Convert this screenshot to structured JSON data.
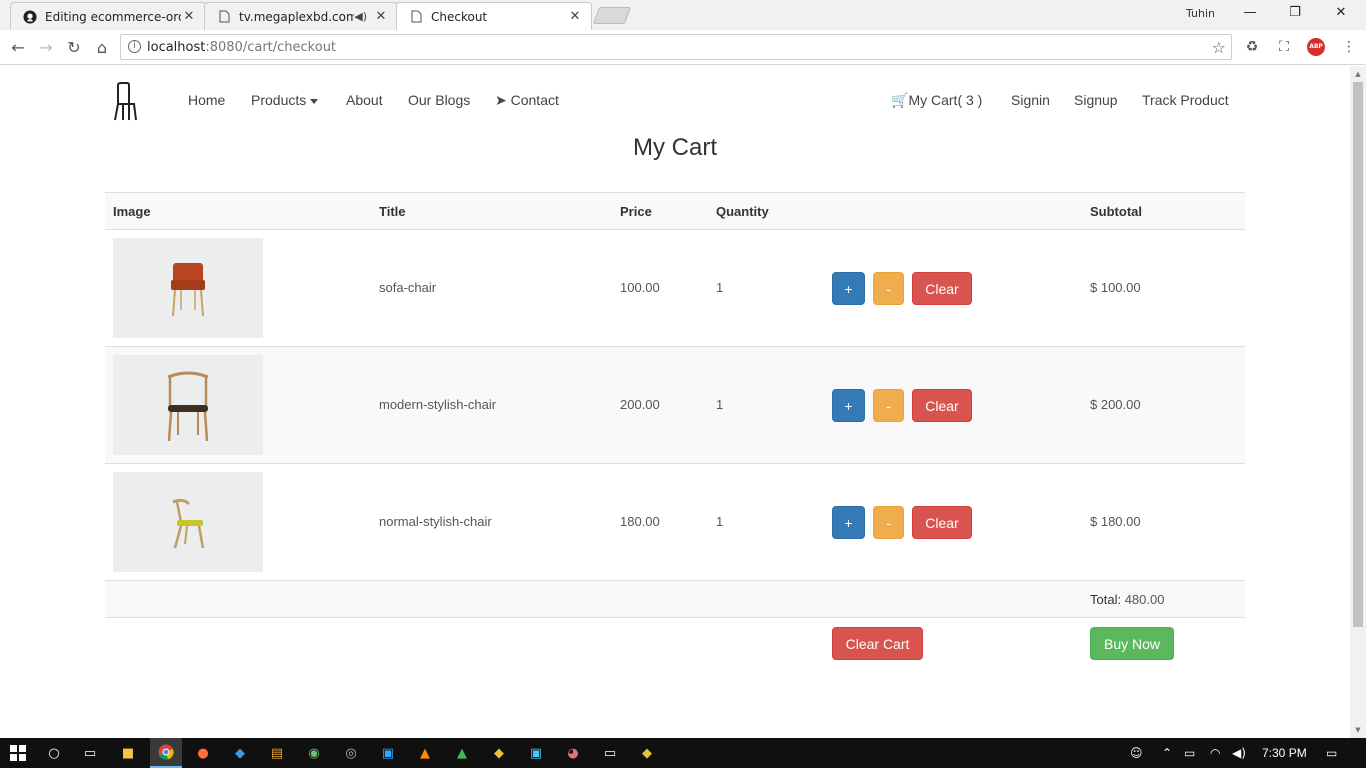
{
  "browser": {
    "tabs": [
      {
        "title": "Editing ecommerce-orde",
        "icon": "github-icon",
        "active": false
      },
      {
        "title": "tv.megaplexbd.com",
        "icon": "page-icon",
        "active": false,
        "audio": true
      },
      {
        "title": "Checkout",
        "icon": "page-icon",
        "active": true
      }
    ],
    "profile_name": "Tuhin",
    "url_host": "localhost",
    "url_rest": ":8080/cart/checkout",
    "abp_label": "ABP"
  },
  "site": {
    "nav": {
      "home": "Home",
      "products": "Products",
      "about": "About",
      "blogs": "Our Blogs",
      "contact": "Contact",
      "cart": "My Cart( 3 )",
      "signin": "Signin",
      "signup": "Signup",
      "track": "Track Product"
    },
    "page_title": "My Cart",
    "table": {
      "headers": {
        "image": "Image",
        "title": "Title",
        "price": "Price",
        "quantity": "Quantity",
        "subtotal": "Subtotal"
      },
      "rows": [
        {
          "title": "sofa-chair",
          "price": "100.00",
          "quantity": "1",
          "subtotal": "$ 100.00",
          "image": "sofa-chair-image"
        },
        {
          "title": "modern-stylish-chair",
          "price": "200.00",
          "quantity": "1",
          "subtotal": "$ 200.00",
          "image": "modern-chair-image"
        },
        {
          "title": "normal-stylish-chair",
          "price": "180.00",
          "quantity": "1",
          "subtotal": "$ 180.00",
          "image": "normal-chair-image"
        }
      ],
      "btn_plus": "+",
      "btn_minus": "-",
      "btn_clear": "Clear",
      "total_label": "Total:",
      "total_value": "480.00",
      "clear_cart": "Clear Cart",
      "buy_now": "Buy Now"
    }
  },
  "taskbar": {
    "clock": "7:30 PM"
  },
  "colors": {
    "primary": "#337ab7",
    "warning": "#f0ad4e",
    "danger": "#d9534f",
    "success": "#5cb85c"
  }
}
